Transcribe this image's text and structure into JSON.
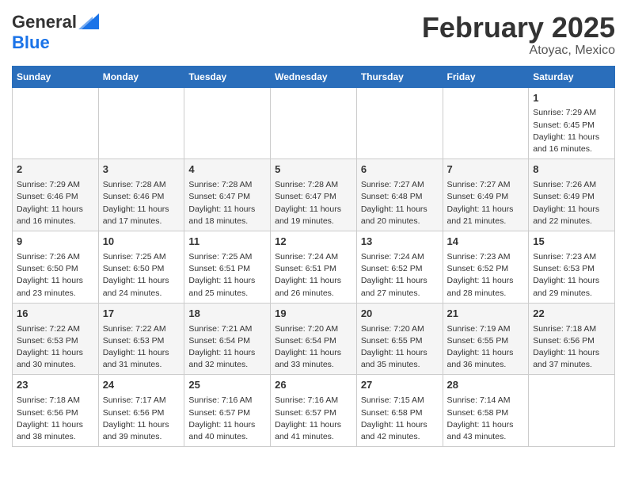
{
  "header": {
    "logo_line1": "General",
    "logo_line2": "Blue",
    "month": "February 2025",
    "location": "Atoyac, Mexico"
  },
  "weekdays": [
    "Sunday",
    "Monday",
    "Tuesday",
    "Wednesday",
    "Thursday",
    "Friday",
    "Saturday"
  ],
  "weeks": [
    [
      {
        "day": "",
        "info": ""
      },
      {
        "day": "",
        "info": ""
      },
      {
        "day": "",
        "info": ""
      },
      {
        "day": "",
        "info": ""
      },
      {
        "day": "",
        "info": ""
      },
      {
        "day": "",
        "info": ""
      },
      {
        "day": "1",
        "info": "Sunrise: 7:29 AM\nSunset: 6:45 PM\nDaylight: 11 hours and 16 minutes."
      }
    ],
    [
      {
        "day": "2",
        "info": "Sunrise: 7:29 AM\nSunset: 6:46 PM\nDaylight: 11 hours and 16 minutes."
      },
      {
        "day": "3",
        "info": "Sunrise: 7:28 AM\nSunset: 6:46 PM\nDaylight: 11 hours and 17 minutes."
      },
      {
        "day": "4",
        "info": "Sunrise: 7:28 AM\nSunset: 6:47 PM\nDaylight: 11 hours and 18 minutes."
      },
      {
        "day": "5",
        "info": "Sunrise: 7:28 AM\nSunset: 6:47 PM\nDaylight: 11 hours and 19 minutes."
      },
      {
        "day": "6",
        "info": "Sunrise: 7:27 AM\nSunset: 6:48 PM\nDaylight: 11 hours and 20 minutes."
      },
      {
        "day": "7",
        "info": "Sunrise: 7:27 AM\nSunset: 6:49 PM\nDaylight: 11 hours and 21 minutes."
      },
      {
        "day": "8",
        "info": "Sunrise: 7:26 AM\nSunset: 6:49 PM\nDaylight: 11 hours and 22 minutes."
      }
    ],
    [
      {
        "day": "9",
        "info": "Sunrise: 7:26 AM\nSunset: 6:50 PM\nDaylight: 11 hours and 23 minutes."
      },
      {
        "day": "10",
        "info": "Sunrise: 7:25 AM\nSunset: 6:50 PM\nDaylight: 11 hours and 24 minutes."
      },
      {
        "day": "11",
        "info": "Sunrise: 7:25 AM\nSunset: 6:51 PM\nDaylight: 11 hours and 25 minutes."
      },
      {
        "day": "12",
        "info": "Sunrise: 7:24 AM\nSunset: 6:51 PM\nDaylight: 11 hours and 26 minutes."
      },
      {
        "day": "13",
        "info": "Sunrise: 7:24 AM\nSunset: 6:52 PM\nDaylight: 11 hours and 27 minutes."
      },
      {
        "day": "14",
        "info": "Sunrise: 7:23 AM\nSunset: 6:52 PM\nDaylight: 11 hours and 28 minutes."
      },
      {
        "day": "15",
        "info": "Sunrise: 7:23 AM\nSunset: 6:53 PM\nDaylight: 11 hours and 29 minutes."
      }
    ],
    [
      {
        "day": "16",
        "info": "Sunrise: 7:22 AM\nSunset: 6:53 PM\nDaylight: 11 hours and 30 minutes."
      },
      {
        "day": "17",
        "info": "Sunrise: 7:22 AM\nSunset: 6:53 PM\nDaylight: 11 hours and 31 minutes."
      },
      {
        "day": "18",
        "info": "Sunrise: 7:21 AM\nSunset: 6:54 PM\nDaylight: 11 hours and 32 minutes."
      },
      {
        "day": "19",
        "info": "Sunrise: 7:20 AM\nSunset: 6:54 PM\nDaylight: 11 hours and 33 minutes."
      },
      {
        "day": "20",
        "info": "Sunrise: 7:20 AM\nSunset: 6:55 PM\nDaylight: 11 hours and 35 minutes."
      },
      {
        "day": "21",
        "info": "Sunrise: 7:19 AM\nSunset: 6:55 PM\nDaylight: 11 hours and 36 minutes."
      },
      {
        "day": "22",
        "info": "Sunrise: 7:18 AM\nSunset: 6:56 PM\nDaylight: 11 hours and 37 minutes."
      }
    ],
    [
      {
        "day": "23",
        "info": "Sunrise: 7:18 AM\nSunset: 6:56 PM\nDaylight: 11 hours and 38 minutes."
      },
      {
        "day": "24",
        "info": "Sunrise: 7:17 AM\nSunset: 6:56 PM\nDaylight: 11 hours and 39 minutes."
      },
      {
        "day": "25",
        "info": "Sunrise: 7:16 AM\nSunset: 6:57 PM\nDaylight: 11 hours and 40 minutes."
      },
      {
        "day": "26",
        "info": "Sunrise: 7:16 AM\nSunset: 6:57 PM\nDaylight: 11 hours and 41 minutes."
      },
      {
        "day": "27",
        "info": "Sunrise: 7:15 AM\nSunset: 6:58 PM\nDaylight: 11 hours and 42 minutes."
      },
      {
        "day": "28",
        "info": "Sunrise: 7:14 AM\nSunset: 6:58 PM\nDaylight: 11 hours and 43 minutes."
      },
      {
        "day": "",
        "info": ""
      }
    ]
  ]
}
